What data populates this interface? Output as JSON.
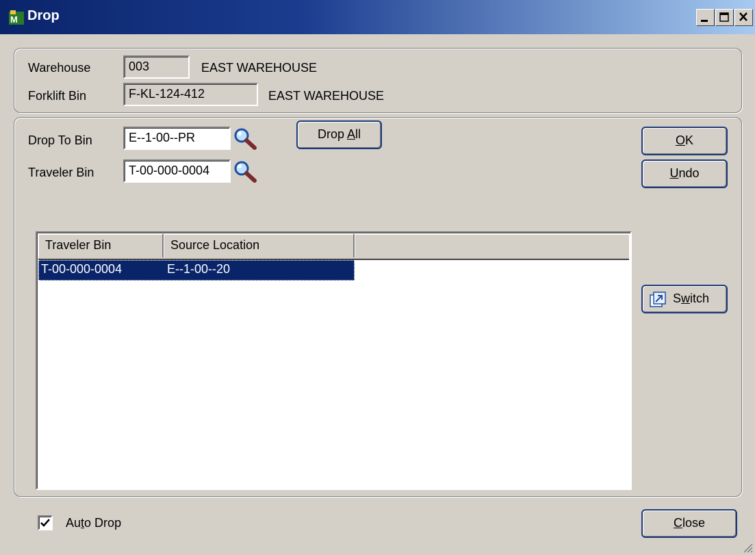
{
  "window": {
    "title": "Drop"
  },
  "header": {
    "warehouse_label": "Warehouse",
    "warehouse_code": "003",
    "warehouse_name": "EAST WAREHOUSE",
    "forklift_label": "Forklift Bin",
    "forklift_bin": "F-KL-124-412",
    "forklift_name": "EAST WAREHOUSE"
  },
  "form": {
    "drop_to_label": "Drop To Bin",
    "drop_to_value": "E--1-00--PR",
    "traveler_label": "Traveler Bin",
    "traveler_value": "T-00-000-0004",
    "drop_all": {
      "pre": "Drop ",
      "key": "A",
      "post": "ll"
    }
  },
  "buttons": {
    "ok": {
      "key": "O",
      "post": "K"
    },
    "undo": {
      "key": "U",
      "post": "ndo"
    },
    "switch": {
      "pre": "S",
      "key": "w",
      "post": "itch"
    },
    "close": {
      "key": "C",
      "post": "lose"
    }
  },
  "grid": {
    "columns": [
      "Traveler Bin",
      "Source Location",
      ""
    ],
    "rows": [
      {
        "traveler_bin": "T-00-000-0004",
        "source_location": "E--1-00--20",
        "selected": true
      }
    ]
  },
  "footer": {
    "auto_drop": {
      "pre": "Au",
      "key": "t",
      "post": "o Drop",
      "checked": true
    }
  },
  "icons": {
    "app": "mas90-app-icon",
    "lookup": "magnifier-lookup-icon",
    "switch": "switch-arrow-icon"
  },
  "colors": {
    "selection": "#0a246a",
    "titlebar_start": "#0a246a",
    "titlebar_end": "#a6caf0"
  }
}
